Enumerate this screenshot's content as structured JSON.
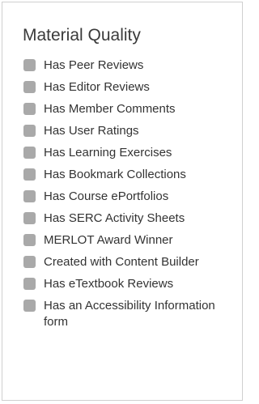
{
  "panel": {
    "title": "Material Quality"
  },
  "filters": [
    {
      "label": "Has Peer Reviews"
    },
    {
      "label": "Has Editor Reviews"
    },
    {
      "label": "Has Member Comments"
    },
    {
      "label": "Has User Ratings"
    },
    {
      "label": "Has Learning Exercises"
    },
    {
      "label": "Has Bookmark Collections"
    },
    {
      "label": "Has Course ePortfolios"
    },
    {
      "label": "Has SERC Activity Sheets"
    },
    {
      "label": "MERLOT Award Winner"
    },
    {
      "label": "Created with Content Builder"
    },
    {
      "label": "Has eTextbook Reviews"
    },
    {
      "label": "Has an Accessibility Information form"
    }
  ],
  "colors": {
    "checkbox": "#a9a9a9",
    "text": "#333333",
    "border": "#cfcfcf"
  }
}
